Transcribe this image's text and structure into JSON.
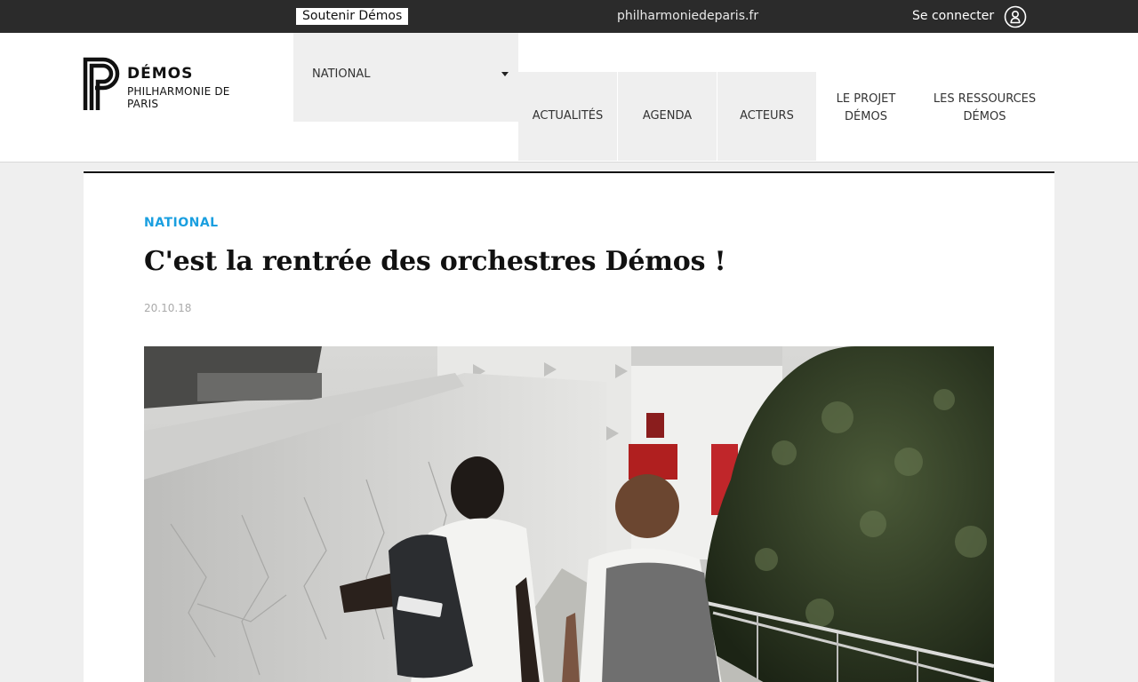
{
  "topbar": {
    "support_label": "Soutenir Démos",
    "site_link": "philharmoniedeparis.fr",
    "login_label": "Se connecter"
  },
  "logo": {
    "title": "DÉMOS",
    "subtitle": "PHILHARMONIE DE PARIS"
  },
  "nav": {
    "dropdown_label": "NATIONAL",
    "items": [
      {
        "line1": "ACTUALITÉS",
        "line2": ""
      },
      {
        "line1": "AGENDA",
        "line2": ""
      },
      {
        "line1": "ACTEURS",
        "line2": ""
      },
      {
        "line1": "LE PROJET",
        "line2": "DÉMOS"
      },
      {
        "line1": "LES RESSOURCES",
        "line2": "DÉMOS"
      }
    ]
  },
  "article": {
    "category": "NATIONAL",
    "title": "C'est la rentrée des orchestres Démos !",
    "date": "20.10.18"
  },
  "colors": {
    "topbar": "#2b2b2b",
    "accent": "#1a9fe0",
    "page_bg": "#efefef"
  }
}
